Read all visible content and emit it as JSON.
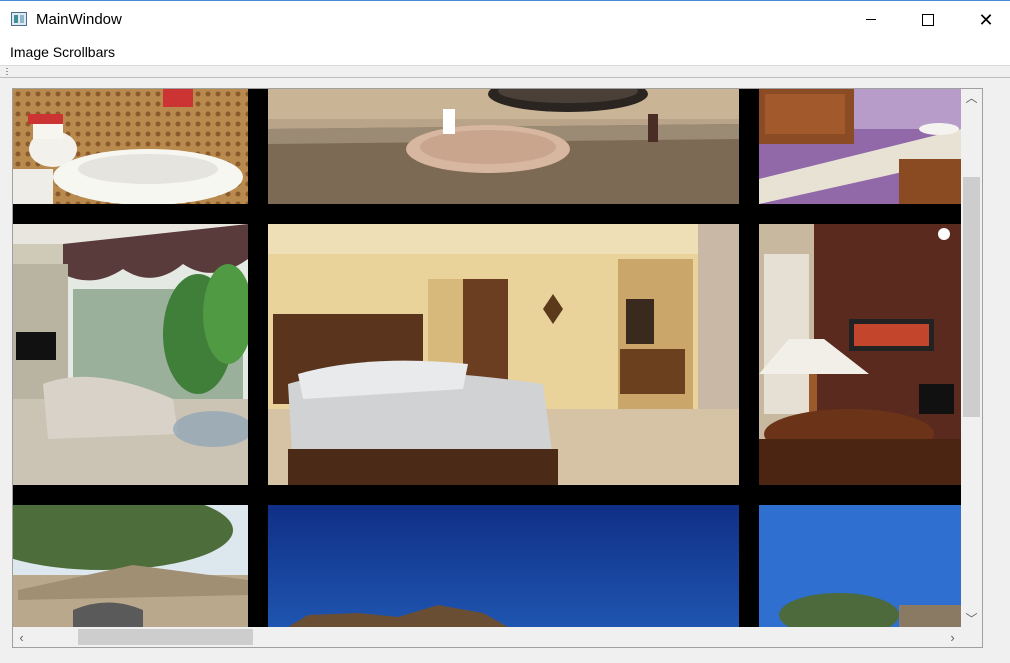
{
  "window": {
    "title": "MainWindow"
  },
  "menu": {
    "items": [
      "Image Scrollbars"
    ]
  },
  "icons": {
    "app": "app-window-icon",
    "minimize": "minimize-icon",
    "maximize": "maximize-icon",
    "close": "close-icon",
    "scroll_up": "chevron-up-icon",
    "scroll_down": "chevron-down-icon",
    "scroll_left": "chevron-left-icon",
    "scroll_right": "chevron-right-icon"
  },
  "colors": {
    "accent_border": "#4a8ad4",
    "canvas_background": "#000000",
    "scroll_thumb": "#cdcdcd"
  }
}
